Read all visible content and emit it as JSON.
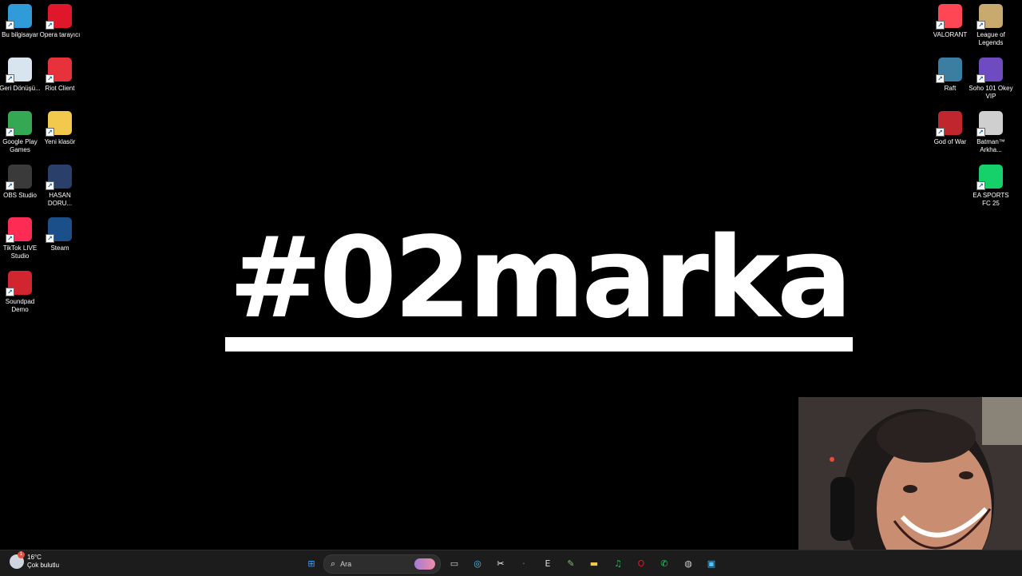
{
  "desktop": {
    "left_icons": [
      {
        "label": "Bu bilgisayar",
        "icon": "monitor-icon",
        "color": "#2f9bd8"
      },
      {
        "label": "Opera tarayıcı",
        "icon": "opera-icon",
        "color": "#e0162b"
      },
      {
        "label": "Geri Dönüşü...",
        "icon": "recycle-bin-icon",
        "color": "#d8e4ee"
      },
      {
        "label": "Riot Client",
        "icon": "riot-icon",
        "color": "#e8323b"
      },
      {
        "label": "Google Play Games",
        "icon": "google-play-games-icon",
        "color": "#34a853"
      },
      {
        "label": "Yeni klasör",
        "icon": "folder-icon",
        "color": "#f2c94c"
      },
      {
        "label": "OBS Studio",
        "icon": "obs-icon",
        "color": "#3a3a3a"
      },
      {
        "label": "HASAN DORU...",
        "icon": "video-file-icon",
        "color": "#2a3f6a"
      },
      {
        "label": "TikTok LIVE Studio",
        "icon": "tiktok-icon",
        "color": "#fe2c55"
      },
      {
        "label": "Steam",
        "icon": "steam-icon",
        "color": "#1b4f8a"
      },
      {
        "label": "Soundpad Demo",
        "icon": "soundpad-icon",
        "color": "#d1252f"
      }
    ],
    "right_icons": [
      {
        "label": "VALORANT",
        "icon": "valorant-icon",
        "color": "#ff4655"
      },
      {
        "label": "League of Legends",
        "icon": "league-of-legends-icon",
        "color": "#c8aa6e"
      },
      {
        "label": "Raft",
        "icon": "raft-icon",
        "color": "#3b7ea1"
      },
      {
        "label": "Soho 101 Okey VIP",
        "icon": "okey-icon",
        "color": "#6f4bc2"
      },
      {
        "label": "God of War",
        "icon": "god-of-war-icon",
        "color": "#c0262d"
      },
      {
        "label": "Batman™ Arkha...",
        "icon": "batman-icon",
        "color": "#cfcfcf"
      },
      {
        "label": "EA SPORTS FC 25",
        "icon": "ea-fc-icon",
        "color": "#16d16a"
      }
    ]
  },
  "wallpaper": {
    "brand_text": "#02marka"
  },
  "taskbar": {
    "weather": {
      "temp": "16°C",
      "condition": "Çok bulutlu"
    },
    "search": {
      "placeholder": "Ara"
    },
    "apps": [
      {
        "name": "start-button",
        "glyph": "⊞",
        "color": "#3aa0ff"
      },
      {
        "name": "task-view",
        "glyph": "▭",
        "color": "#cfcfcf"
      },
      {
        "name": "copilot",
        "glyph": "◎",
        "color": "#4fc3f7"
      },
      {
        "name": "capcut",
        "glyph": "✂",
        "color": "#ffffff"
      },
      {
        "name": "separator",
        "glyph": "·",
        "color": "#888888"
      },
      {
        "name": "epic-games",
        "glyph": "E",
        "color": "#dddddd"
      },
      {
        "name": "notepad-plus",
        "glyph": "✎",
        "color": "#7cc46a"
      },
      {
        "name": "file-explorer",
        "glyph": "▬",
        "color": "#f2c94c"
      },
      {
        "name": "spotify",
        "glyph": "♫",
        "color": "#1db954"
      },
      {
        "name": "opera",
        "glyph": "O",
        "color": "#e0162b"
      },
      {
        "name": "whatsapp",
        "glyph": "✆",
        "color": "#25d366"
      },
      {
        "name": "obs",
        "glyph": "◍",
        "color": "#cccccc"
      },
      {
        "name": "store",
        "glyph": "▣",
        "color": "#4fc3f7"
      }
    ]
  }
}
